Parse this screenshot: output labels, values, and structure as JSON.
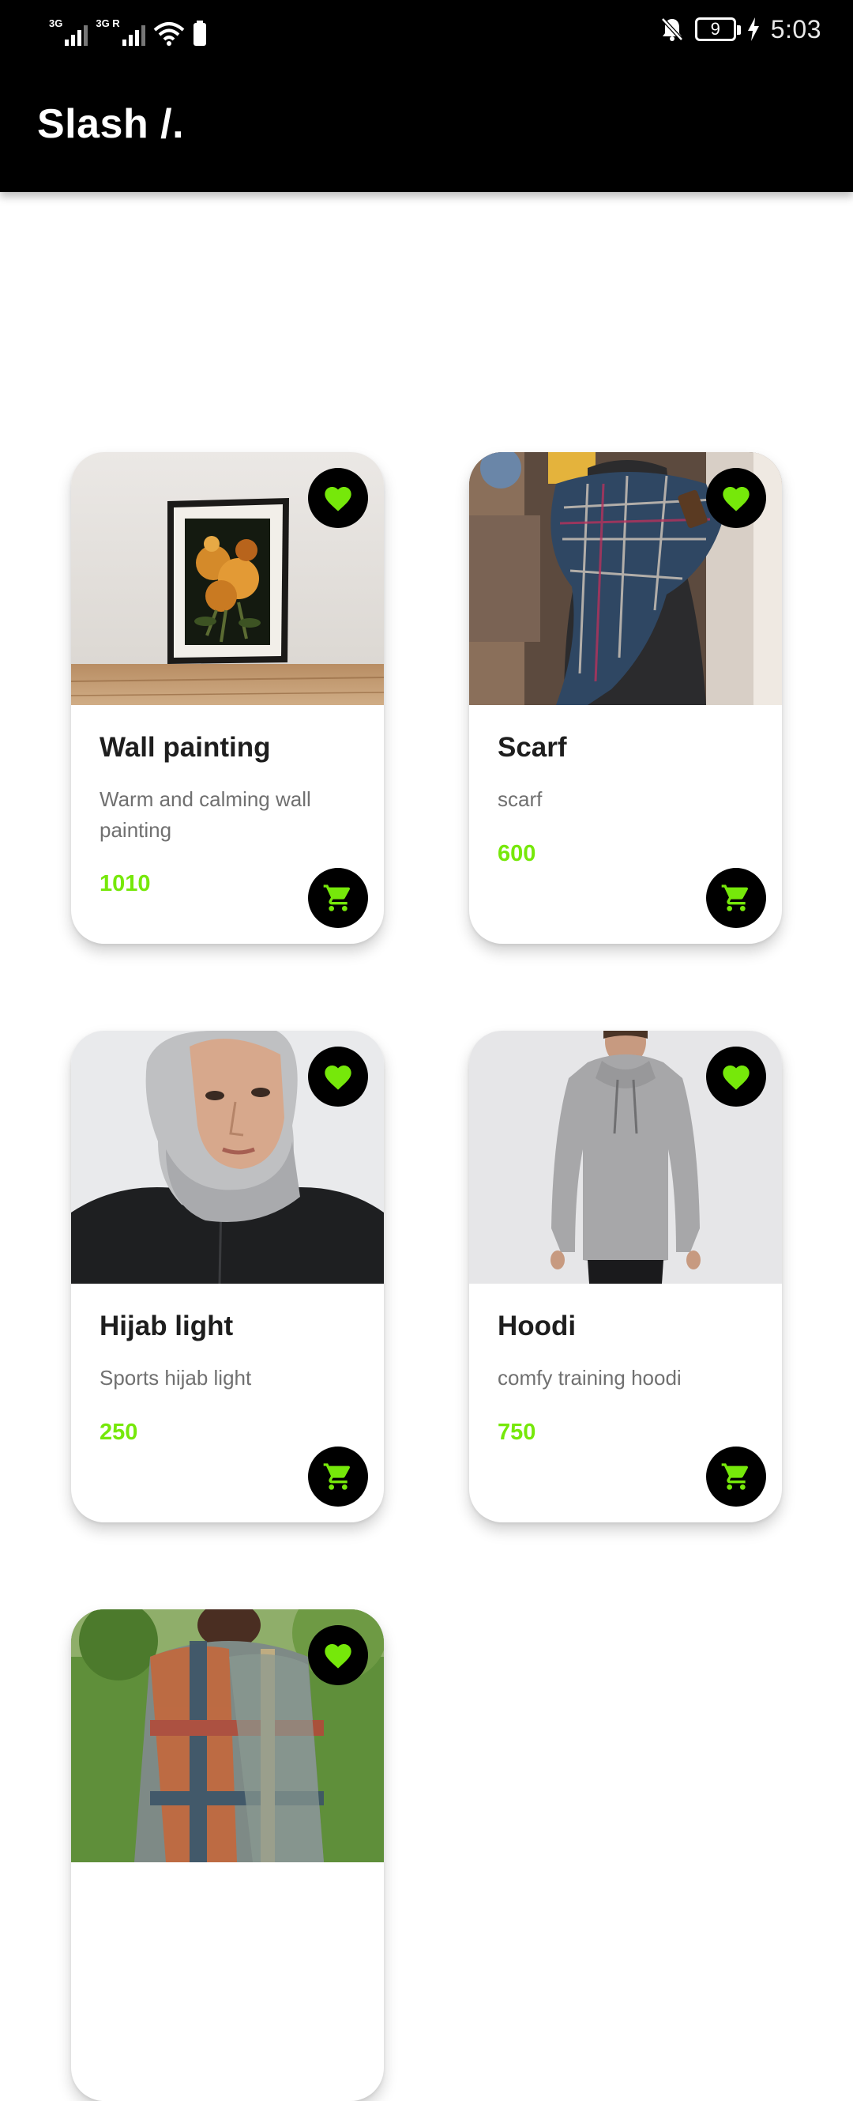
{
  "status_bar": {
    "sim1_label": "3G",
    "sim2_label": "3G R",
    "battery_level": "9",
    "time": "5:03"
  },
  "app": {
    "title": "Slash /."
  },
  "colors": {
    "accent": "#76e80a",
    "appbar": "#000000",
    "title_text": "#1e1e1e",
    "desc_text": "#707070"
  },
  "products": [
    {
      "title": "Wall painting",
      "description": "Warm and calming wall painting",
      "price": "1010",
      "favorite": true
    },
    {
      "title": "Scarf",
      "description": "scarf",
      "price": "600",
      "favorite": true
    },
    {
      "title": "Hijab light",
      "description": "Sports hijab light",
      "price": "250",
      "favorite": true
    },
    {
      "title": "Hoodi",
      "description": "comfy training hoodi",
      "price": "750",
      "favorite": true
    },
    {
      "title": "",
      "description": "",
      "price": "",
      "favorite": true
    }
  ]
}
